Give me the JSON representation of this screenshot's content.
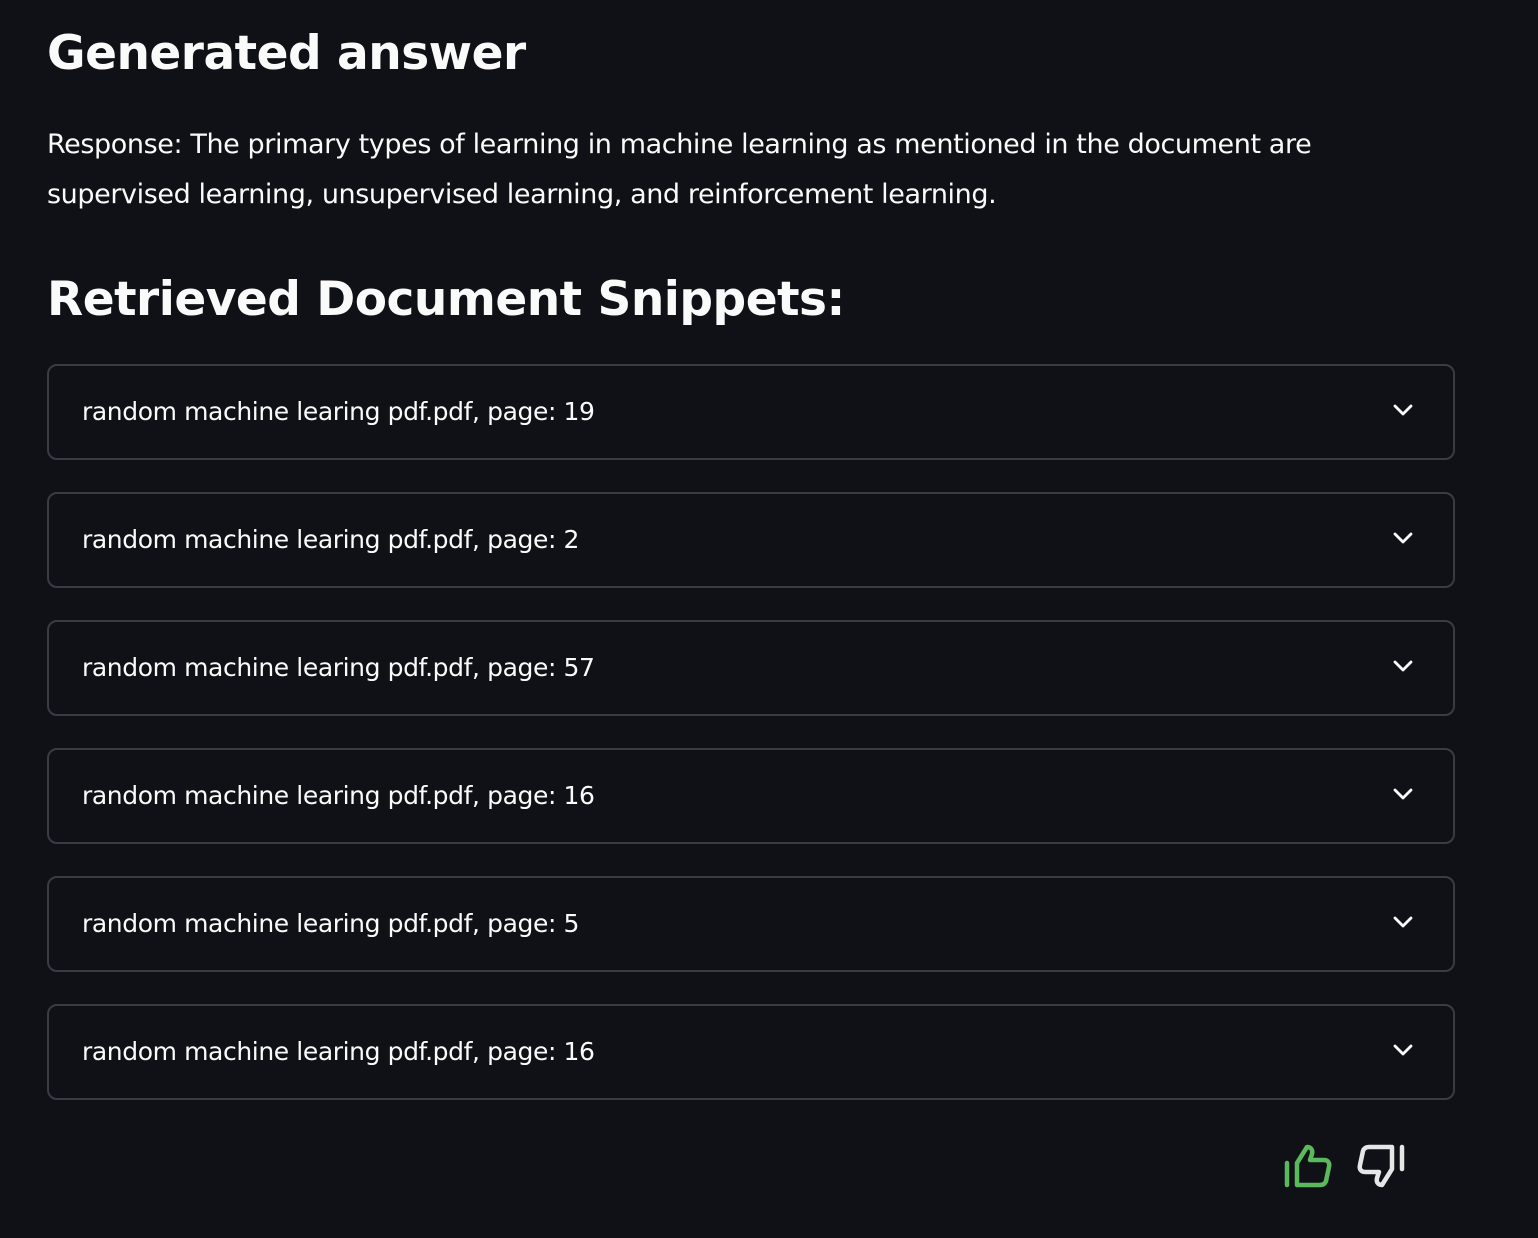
{
  "answer": {
    "title": "Generated answer",
    "response": "Response: The primary types of learning in machine learning as mentioned in the document are supervised learning, unsupervised learning, and reinforcement learning."
  },
  "snippets": {
    "title": "Retrieved Document Snippets:",
    "items": [
      {
        "label": "random machine learing pdf.pdf, page: 19"
      },
      {
        "label": "random machine learing pdf.pdf, page: 2"
      },
      {
        "label": "random machine learing pdf.pdf, page: 57"
      },
      {
        "label": "random machine learing pdf.pdf, page: 16"
      },
      {
        "label": "random machine learing pdf.pdf, page: 5"
      },
      {
        "label": "random machine learing pdf.pdf, page: 16"
      }
    ]
  },
  "feedback": {
    "thumbs_up_icon": "thumbs-up-icon",
    "thumbs_down_icon": "thumbs-down-icon",
    "thumbs_up_color": "#5cb85c",
    "thumbs_down_color": "#e6e6e6"
  },
  "colors": {
    "background": "#0f1116",
    "border": "#3a3c45",
    "text": "#fafafa"
  }
}
